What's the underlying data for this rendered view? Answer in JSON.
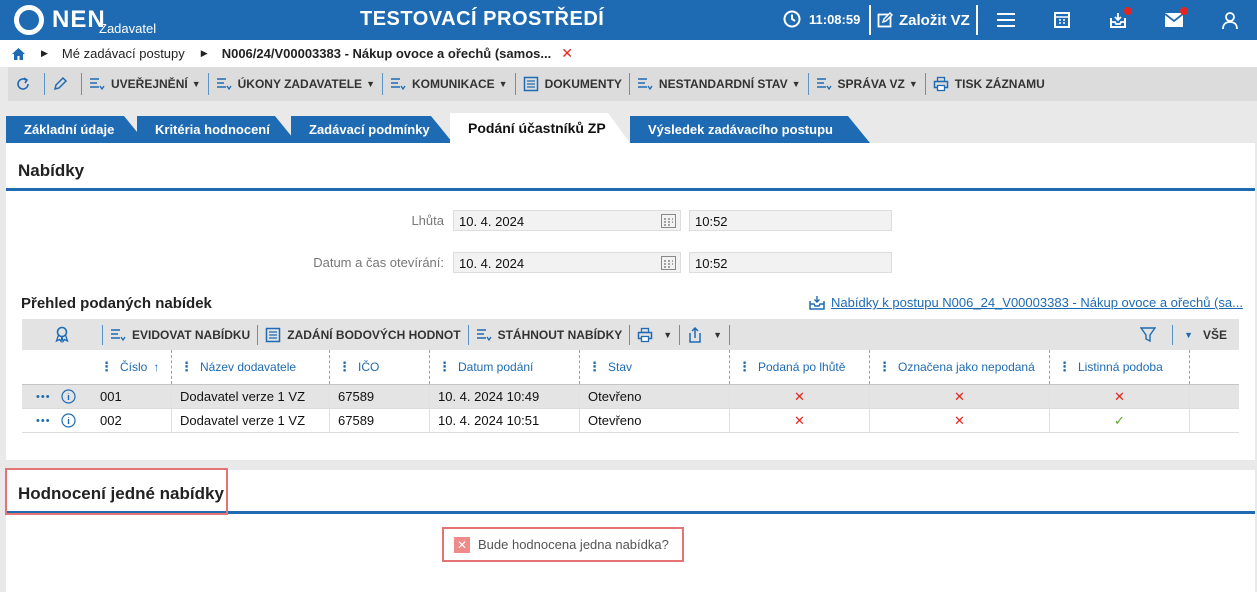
{
  "header": {
    "logo_text": "NEN",
    "logo_sub": "Zadavatel",
    "env_title": "TESTOVACÍ PROSTŘEDÍ",
    "clock": "11:08:59",
    "create_label": "Založit VZ"
  },
  "breadcrumb": {
    "item1": "Mé zadávací postupy",
    "item2": "N006/24/V00003383 - Nákup ovoce a ořechů (samos..."
  },
  "toolbar": {
    "uverejneni": "UVEŘEJNĚNÍ",
    "ukony": "ÚKONY ZADAVATELE",
    "komunikace": "KOMUNIKACE",
    "dokumenty": "DOKUMENTY",
    "nestandardni": "NESTANDARDNÍ STAV",
    "sprava": "SPRÁVA VZ",
    "tisk": "TISK ZÁZNAMU"
  },
  "tabs": {
    "t1": "Základní údaje",
    "t2": "Kritéria hodnocení",
    "t3": "Zadávací podmínky",
    "t4": "Podání účastníků ZP",
    "t5": "Výsledek zadávacího postupu"
  },
  "nabidky": {
    "title": "Nabídky",
    "lhuta_label": "Lhůta",
    "lhuta_date": "10. 4. 2024",
    "lhuta_time": "10:52",
    "otevirani_label": "Datum a čas otevírání:",
    "otevirani_date": "10. 4. 2024",
    "otevirani_time": "10:52",
    "prehled_title": "Přehled podaných nabídek",
    "link_text": "Nabídky k postupu N006_24_V00003383 - Nákup ovoce a ořechů (sa..."
  },
  "grid_toolbar": {
    "evidovat": "EVIDOVAT NABÍDKU",
    "zadani": "ZADÁNÍ BODOVÝCH HODNOT",
    "stahnout": "STÁHNOUT NABÍDKY",
    "vse": "VŠE"
  },
  "grid": {
    "headers": {
      "cislo": "Číslo",
      "nazev": "Název dodavatele",
      "ico": "IČO",
      "datum": "Datum podání",
      "stav": "Stav",
      "podana": "Podaná po lhůtě",
      "oznacena": "Označena jako nepodaná",
      "listinna": "Listinná podoba"
    },
    "rows": [
      {
        "cislo": "001",
        "nazev": "Dodavatel verze 1 VZ",
        "ico": "67589",
        "datum": "10. 4. 2024 10:49",
        "stav": "Otevřeno",
        "podana": "✕",
        "oznacena": "✕",
        "listinna": "✕"
      },
      {
        "cislo": "002",
        "nazev": "Dodavatel verze 1 VZ",
        "ico": "67589",
        "datum": "10. 4. 2024 10:51",
        "stav": "Otevřeno",
        "podana": "✕",
        "oznacena": "✕",
        "listinna": "✓"
      }
    ]
  },
  "hodnoceni": {
    "title": "Hodnocení jedné nabídky",
    "warning": "Bude hodnocena jedna nabídka?"
  },
  "colors": {
    "brand": "#1e6bb3",
    "error": "#e52521",
    "ok": "#5aa52c"
  }
}
